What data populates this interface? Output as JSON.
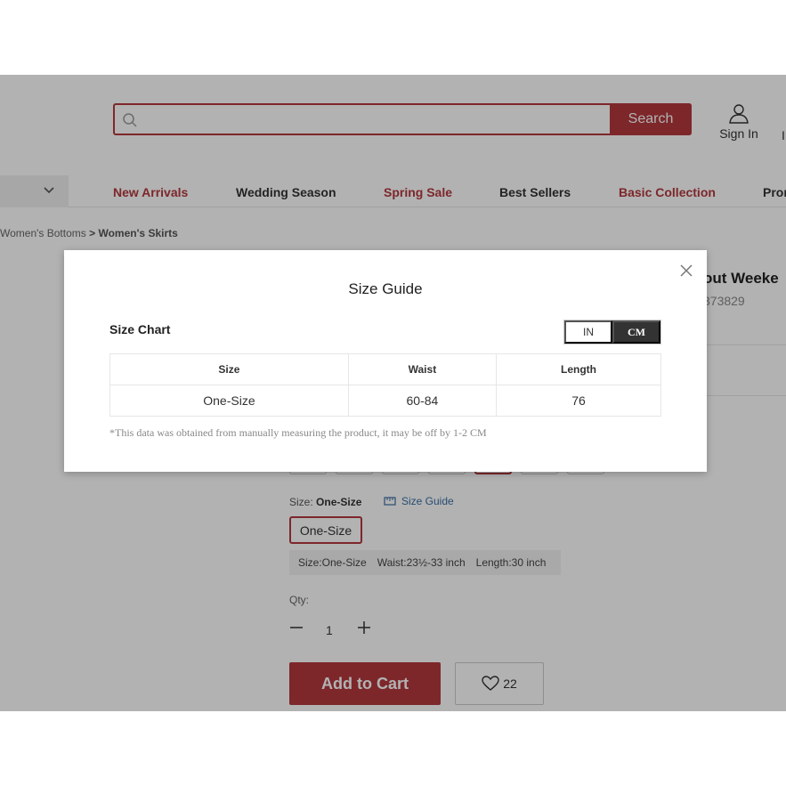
{
  "header": {
    "search_placeholder": "",
    "search_button": "Search",
    "sign_in": "Sign In",
    "edge_text": "I"
  },
  "nav": {
    "items": [
      {
        "label": "New Arrivals",
        "color": "#b3383e"
      },
      {
        "label": "Wedding Season",
        "color": "#333333"
      },
      {
        "label": "Spring Sale",
        "color": "#b3383e"
      },
      {
        "label": "Best Sellers",
        "color": "#333333"
      },
      {
        "label": "Basic Collection",
        "color": "#b3383e"
      },
      {
        "label": "Pron",
        "color": "#333333"
      }
    ]
  },
  "breadcrumb": {
    "parent": "Women's Bottoms",
    "current": "> Women's Skirts"
  },
  "product": {
    "title": "out Weeke",
    "sku": "373829",
    "size_label": "Size:",
    "size_value": "One-Size",
    "size_guide_link": "Size Guide",
    "size_option": "One-Size",
    "size_detail": {
      "size": "Size:One-Size",
      "waist": "Waist:23½-33 inch",
      "length": "Length:30 inch"
    },
    "qty_label": "Qty:",
    "qty_value": "1",
    "add_to_cart": "Add to Cart",
    "wishlist_count": "22"
  },
  "modal": {
    "title": "Size Guide",
    "chart_heading": "Size Chart",
    "units": [
      "IN",
      "CM"
    ],
    "active_unit": "CM",
    "table": {
      "headers": [
        "Size",
        "Waist",
        "Length"
      ],
      "rows": [
        [
          "One-Size",
          "60-84",
          "76"
        ]
      ]
    },
    "disclaimer": "*This data was obtained from manually measuring the product, it may be off by 1-2 CM"
  },
  "colors": {
    "accent": "#b3383e",
    "link": "#3a6ea5"
  }
}
